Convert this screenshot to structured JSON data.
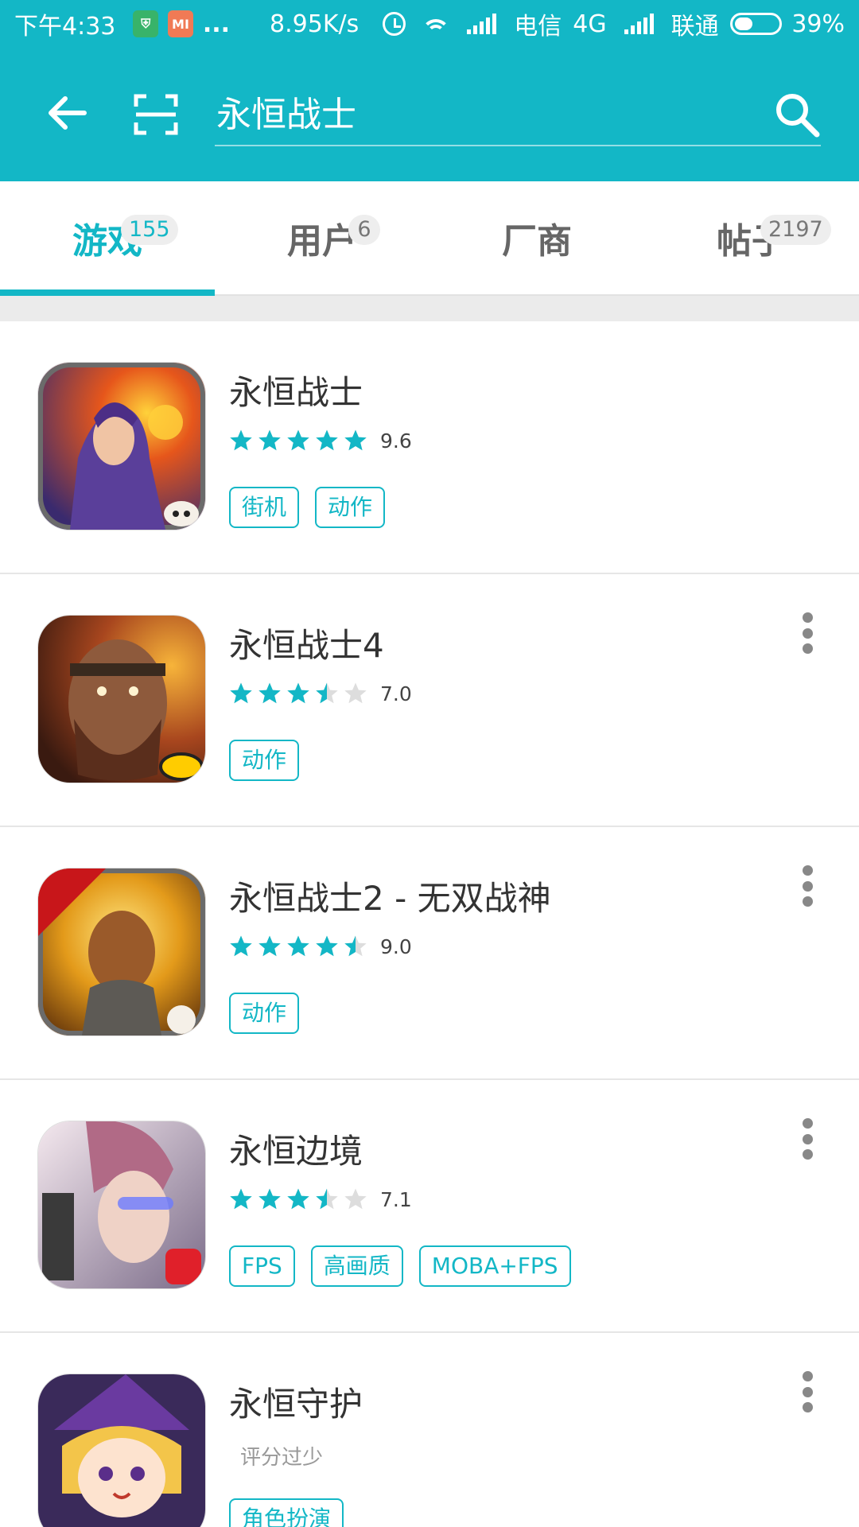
{
  "status_bar": {
    "time": "下午4:33",
    "speed": "8.95K/s",
    "carrier1": "电信",
    "network": "4G",
    "carrier2": "联通",
    "battery": "39%",
    "battery_level": 0.39,
    "mi_badge": "MI",
    "dots": "..."
  },
  "search": {
    "query": "永恒战士"
  },
  "tabs": [
    {
      "label": "游戏",
      "count": "155",
      "active": true
    },
    {
      "label": "用户",
      "count": "6",
      "active": false
    },
    {
      "label": "厂商",
      "count": "",
      "active": false
    },
    {
      "label": "帖子",
      "count": "2197",
      "active": false
    }
  ],
  "results": [
    {
      "name": "永恒战士",
      "rating": 9.6,
      "score": "9.6",
      "stars": 5,
      "tags": [
        "街机",
        "动作"
      ],
      "icon": "hero-sorceress-icon"
    },
    {
      "name": "永恒战士4",
      "rating": 7.0,
      "score": "7.0",
      "stars": 3.5,
      "tags": [
        "动作"
      ],
      "icon": "bearded-warrior-icon"
    },
    {
      "name": "永恒战士2 - 无双战神",
      "rating": 9.0,
      "score": "9.0",
      "stars": 4.5,
      "tags": [
        "动作"
      ],
      "icon": "pvp-warrior-icon"
    },
    {
      "name": "永恒边境",
      "rating": 7.1,
      "score": "7.1",
      "stars": 3.5,
      "tags": [
        "FPS",
        "高画质",
        "MOBA+FPS"
      ],
      "icon": "cyber-gunner-icon"
    },
    {
      "name": "永恒守护",
      "rating": null,
      "score": "",
      "no_rating": "评分过少",
      "stars": 0,
      "tags": [
        "角色扮演"
      ],
      "icon": "witch-girl-icon"
    }
  ],
  "colors": {
    "accent": "#13b7c6",
    "star_empty": "#dddddd"
  }
}
